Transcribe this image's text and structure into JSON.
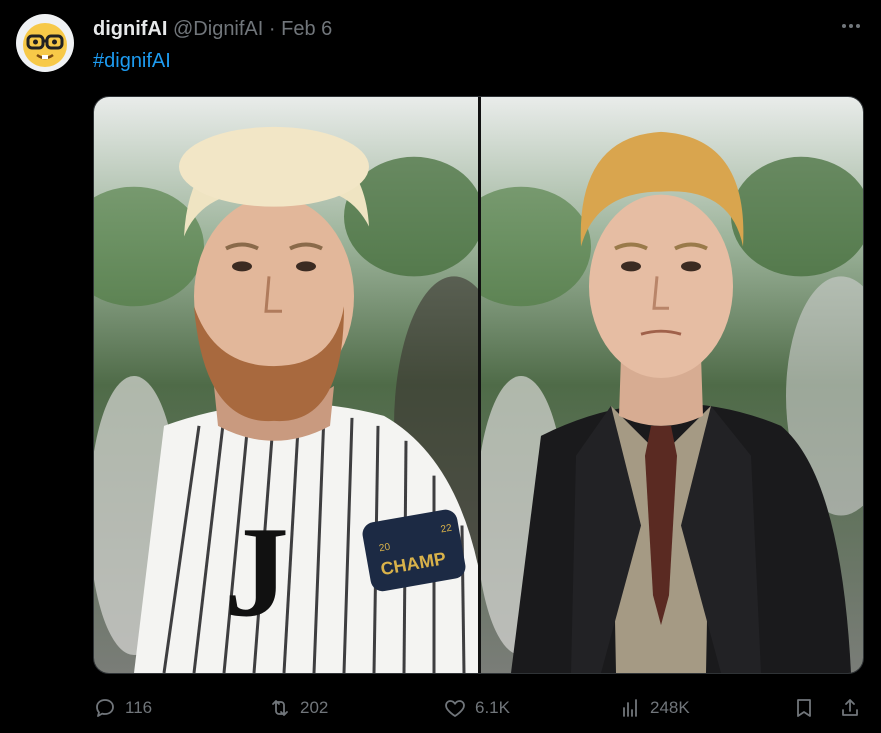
{
  "author": {
    "display_name": "dignifAI",
    "handle": "@DignifAI",
    "separator": "·",
    "date": "Feb 6",
    "avatar_icon": "nerd-face-emoji"
  },
  "tweet": {
    "text": "#dignifAI"
  },
  "media": {
    "photos": [
      {
        "icon": "photo-original",
        "jersey_text": "CHAMP",
        "jersey_year_left": "20",
        "jersey_year_right": "22"
      },
      {
        "icon": "photo-edited"
      }
    ]
  },
  "actions": {
    "reply_count": "116",
    "retweet_count": "202",
    "like_count": "6.1K",
    "view_count": "248K"
  },
  "colors": {
    "background": "#000000",
    "text_primary": "#e7e9ea",
    "text_secondary": "#71767b",
    "link": "#1d9bf0"
  }
}
